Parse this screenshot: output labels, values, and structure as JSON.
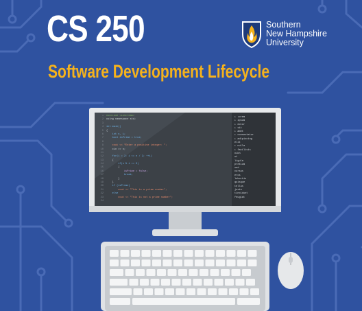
{
  "header": {
    "course_code": "CS 250",
    "course_title": "Software Development Lifecycle"
  },
  "logo": {
    "line1": "Southern",
    "line2": "New Hampshire",
    "line3": "University",
    "icon": "flame-shield-icon",
    "shield_color": "#1d3a7a",
    "flame_color": "#f5b21c"
  },
  "colors": {
    "background": "#2f52a0",
    "circuit": "#4a6bb6",
    "title_accent": "#f5b21c"
  },
  "editor": {
    "code_lines": [
      {
        "n": "1",
        "t": "#include <iostream>",
        "c": "cm"
      },
      {
        "n": "2",
        "t": "using namespace std;",
        "c": ""
      },
      {
        "n": "3",
        "t": "",
        "c": ""
      },
      {
        "n": "4",
        "t": "int main()",
        "c": "kw"
      },
      {
        "n": "5",
        "t": "{",
        "c": ""
      },
      {
        "n": "6",
        "t": "    int n, i;",
        "c": "kw"
      },
      {
        "n": "7",
        "t": "    bool isPrime = true;",
        "c": "kw"
      },
      {
        "n": "8",
        "t": "",
        "c": ""
      },
      {
        "n": "9",
        "t": "    cout << \"Enter a positive integer: \";",
        "c": "str"
      },
      {
        "n": "10",
        "t": "    cin >> n;",
        "c": ""
      },
      {
        "n": "11",
        "t": "",
        "c": ""
      },
      {
        "n": "12",
        "t": "    for(i = 2; i <= n / 2; ++i)",
        "c": "kw"
      },
      {
        "n": "13",
        "t": "    {",
        "c": ""
      },
      {
        "n": "14",
        "t": "        if(n % i == 0)",
        "c": "kw"
      },
      {
        "n": "15",
        "t": "        {",
        "c": ""
      },
      {
        "n": "16",
        "t": "            isPrime = false;",
        "c": "num"
      },
      {
        "n": "17",
        "t": "            break;",
        "c": "kw"
      },
      {
        "n": "18",
        "t": "        }",
        "c": ""
      },
      {
        "n": "19",
        "t": "    }",
        "c": ""
      },
      {
        "n": "20",
        "t": "    if (isPrime)",
        "c": "kw"
      },
      {
        "n": "21",
        "t": "        cout << \"This is a prime number\";",
        "c": "str"
      },
      {
        "n": "22",
        "t": "    else",
        "c": "kw"
      },
      {
        "n": "23",
        "t": "        cout << \"This is not a prime number\";",
        "c": "str"
      },
      {
        "n": "24",
        "t": "",
        "c": ""
      },
      {
        "n": "25",
        "t": "    return 0;",
        "c": "kw"
      },
      {
        "n": "26",
        "t": "}",
        "c": ""
      },
      {
        "n": "27",
        "t": "",
        "c": ""
      }
    ],
    "file_list": [
      "▸ lorem",
      "▸ ipsum",
      "▸ dolor",
      "▸ sit",
      "▸ amet",
      "▸ consectetur",
      "▸ adipiscing",
      "  elit",
      "▸ nulla",
      "▸ facilisis",
      "  nibh",
      "  ut",
      "  ligula",
      "  pretium",
      "  sed",
      "  cursus",
      "  eros",
      "  lobortis",
      "  quisque",
      "  tellus",
      "  justo",
      "  tincidunt",
      "  feugiat"
    ]
  }
}
